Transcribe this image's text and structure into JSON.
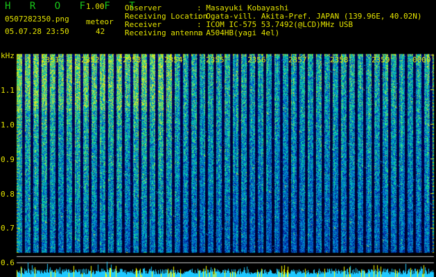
{
  "header": {
    "app_title": "H R O F F T",
    "app_version": "1.00",
    "file_name": "0507282350.png",
    "datetime": "05.07.28 23:50",
    "meteor_label": "meteor",
    "meteor_count": "42"
  },
  "info": [
    {
      "key": "Observer",
      "value": ": Masayuki Kobayashi"
    },
    {
      "key": "Receiving Location",
      "value": ": Ogata-vill. Akita-Pref. JAPAN (139.96E, 40.02N)"
    },
    {
      "key": "Receiver",
      "value": ": ICOM IC-575 53.7492(@LCD)MHz USB"
    },
    {
      "key": "Receiving antenna",
      "value": ": A504HB(yagi 4el)"
    }
  ],
  "spectrogram": {
    "y_unit": "kHz",
    "y_ticks": [
      "1.1",
      "1.0",
      "0.9",
      "0.8",
      "0.7",
      "0.6"
    ],
    "time_ticks": [
      "2351",
      "2352",
      "2353",
      "2354",
      "2355",
      "2356",
      "2357",
      "2358",
      "2359",
      "0000"
    ],
    "colors": {
      "label": "#e6e600",
      "title": "#19c819",
      "background": "#000000"
    }
  }
}
